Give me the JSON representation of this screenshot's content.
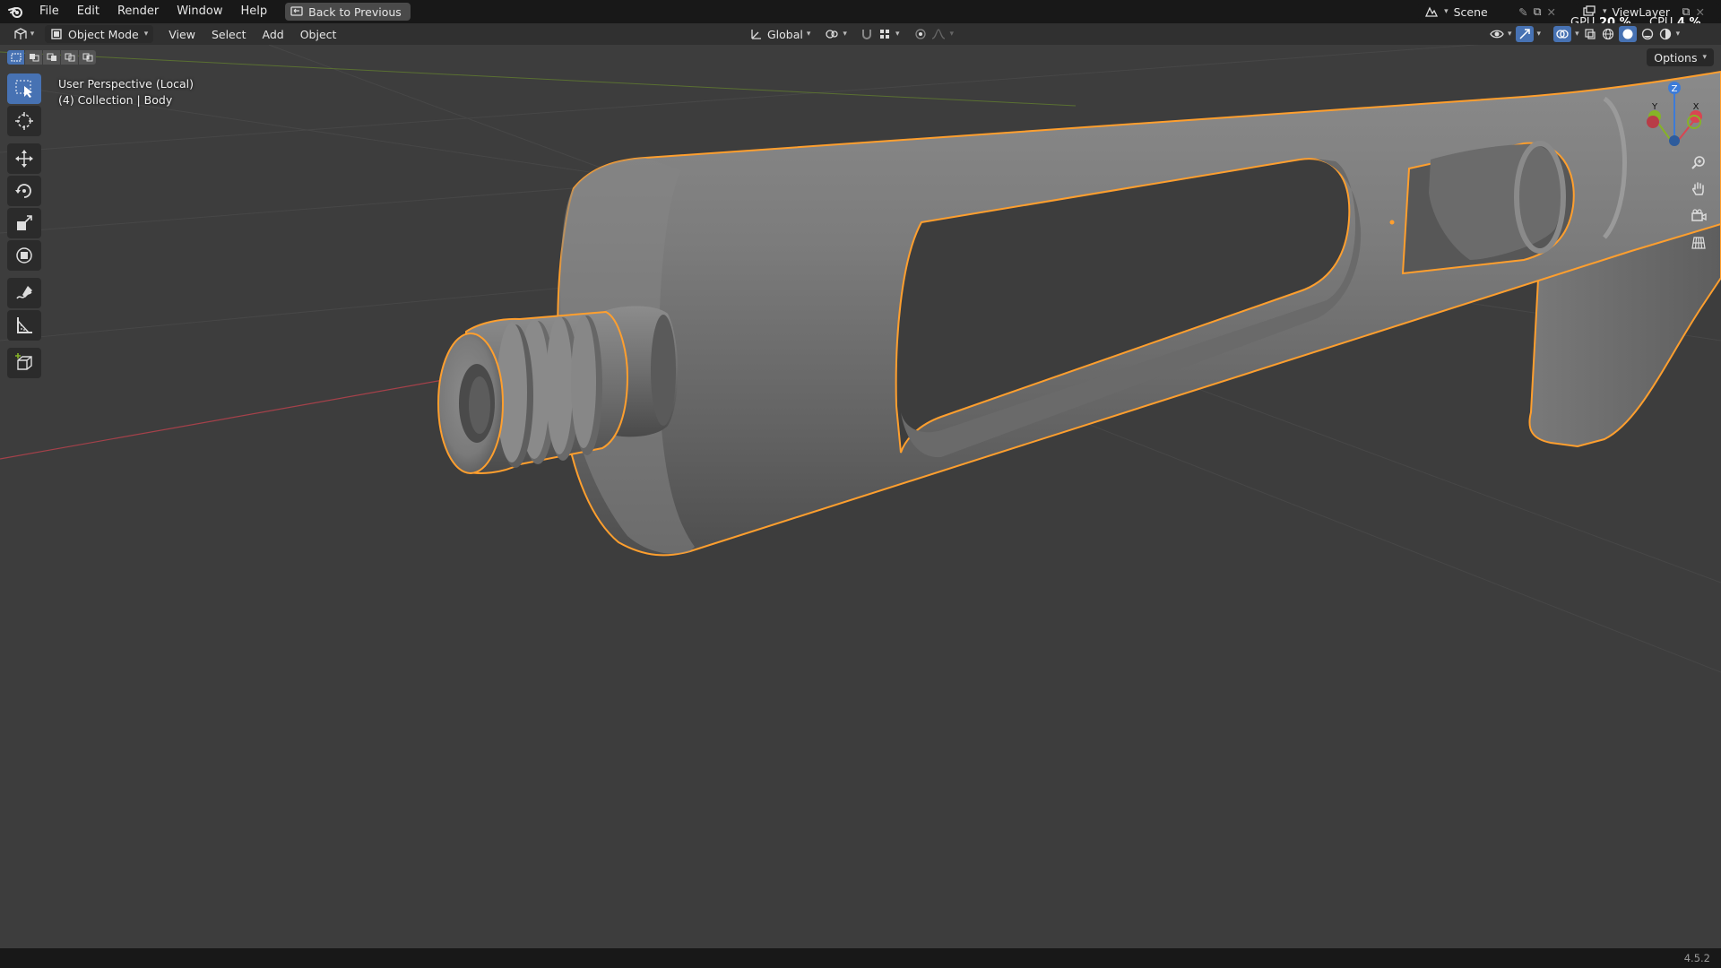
{
  "menubar": {
    "items": [
      "File",
      "Edit",
      "Render",
      "Window",
      "Help"
    ],
    "back_button": "Back to Previous",
    "scene_name": "Scene",
    "view_layer": "ViewLayer",
    "gpu_label": "GPU",
    "gpu_value": "20 %",
    "cpu_label": "CPU",
    "cpu_value": "4 %"
  },
  "header": {
    "mode": "Object Mode",
    "menus": [
      "View",
      "Select",
      "Add",
      "Object"
    ],
    "transform_orientation": "Global"
  },
  "viewport": {
    "perspective_label": "User Perspective (Local)",
    "collection_label": "(4) Collection | Body",
    "options_label": "Options",
    "axis_labels": {
      "x": "X",
      "y": "Y",
      "z": "Z"
    }
  },
  "tools": [
    "select-box",
    "cursor",
    "move",
    "rotate",
    "scale",
    "transform",
    "annotate",
    "measure",
    "add-cube"
  ],
  "statusbar": {
    "version": "4.5.2"
  },
  "colors": {
    "selection_outline": "#ff9f2e",
    "accent": "#4772b3",
    "viewport_bg": "#3d3d3d",
    "axis_x": "#d94552",
    "axis_y": "#86b327",
    "axis_z": "#3c7bd9"
  }
}
